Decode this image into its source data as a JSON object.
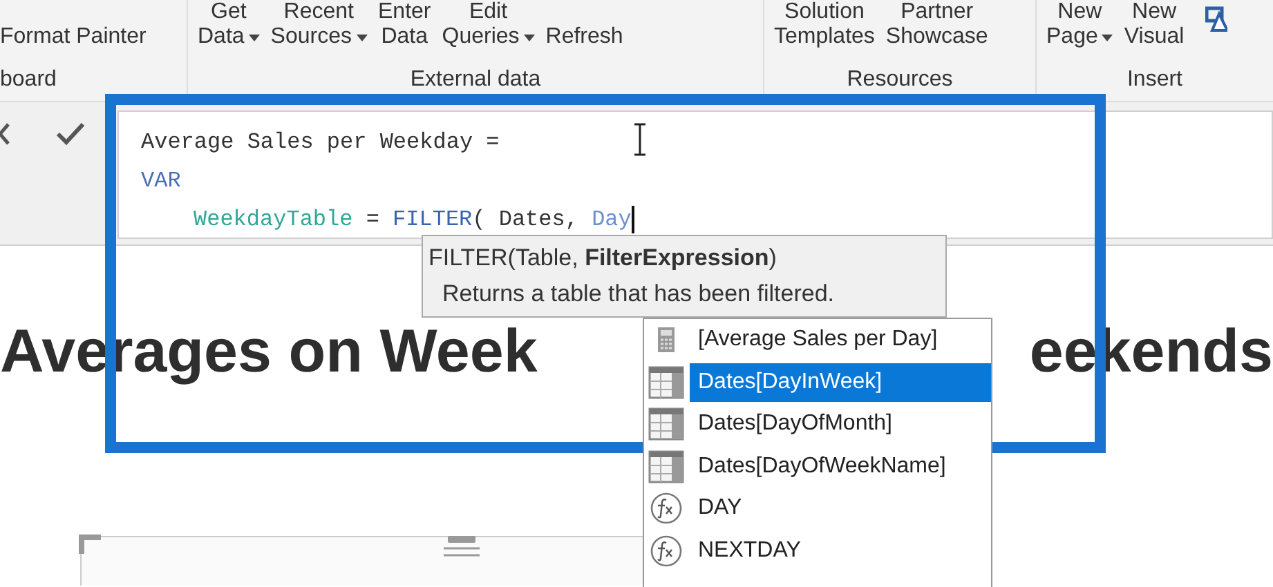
{
  "ribbon": {
    "groups": [
      {
        "label": "board",
        "buttons": [
          {
            "lines": [
              "Format Painter"
            ],
            "has_menu": false
          }
        ]
      },
      {
        "label": "External data",
        "buttons": [
          {
            "lines": [
              "Get",
              "Data"
            ],
            "has_menu": true
          },
          {
            "lines": [
              "Recent",
              "Sources"
            ],
            "has_menu": true
          },
          {
            "lines": [
              "Enter",
              "Data"
            ],
            "has_menu": false
          },
          {
            "lines": [
              "Edit",
              "Queries"
            ],
            "has_menu": true
          },
          {
            "lines": [
              "Refresh"
            ],
            "has_menu": false
          }
        ]
      },
      {
        "label": "Resources",
        "buttons": [
          {
            "lines": [
              "Solution",
              "Templates"
            ],
            "has_menu": false
          },
          {
            "lines": [
              "Partner",
              "Showcase"
            ],
            "has_menu": false
          }
        ]
      },
      {
        "label": "Insert",
        "buttons": [
          {
            "lines": [
              "New",
              "Page"
            ],
            "has_menu": true
          },
          {
            "lines": [
              "New",
              "Visual"
            ],
            "has_menu": false
          }
        ]
      }
    ]
  },
  "formula": {
    "lines": [
      {
        "tokens": [
          {
            "text": "Average Sales per Weekday =",
            "kind": "plain"
          }
        ]
      },
      {
        "tokens": [
          {
            "text": "VAR",
            "kind": "keyword"
          }
        ],
        "children": [
          {
            "tokens": [
              {
                "text": "WeekdayTable",
                "kind": "variable"
              },
              {
                "text": " = ",
                "kind": "plain"
              },
              {
                "text": "FILTER",
                "kind": "function"
              },
              {
                "text": "( Dates, ",
                "kind": "plain"
              },
              {
                "text": "Day",
                "kind": "partial"
              }
            ]
          }
        ]
      }
    ]
  },
  "tooltip": {
    "signature": "FILTER(Table, **FilterExpression**)",
    "description": "Returns a table that has been filtered."
  },
  "autocomplete": [
    {
      "label": "[Average Sales per Day]",
      "kind": "measure",
      "selected": false
    },
    {
      "label": "Dates[DayInWeek]",
      "kind": "column",
      "selected": true
    },
    {
      "label": "Dates[DayOfMonth]",
      "kind": "column",
      "selected": false
    },
    {
      "label": "Dates[DayOfWeekName]",
      "kind": "column",
      "selected": false
    },
    {
      "label": "DAY",
      "kind": "function",
      "selected": false
    },
    {
      "label": "NEXTDAY",
      "kind": "function",
      "selected": false
    }
  ],
  "report": {
    "title_left": "Averages on Week",
    "title_right": "eekends"
  }
}
